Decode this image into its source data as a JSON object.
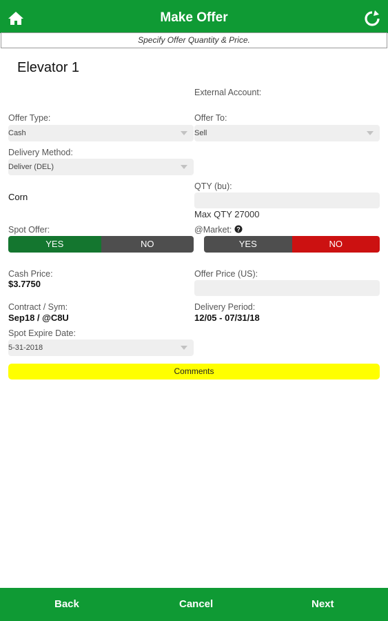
{
  "header": {
    "title": "Make Offer",
    "home_icon": "home-icon",
    "refresh_icon": "refresh-icon"
  },
  "subheader": {
    "text": "Specify Offer Quantity & Price."
  },
  "elevator": {
    "name": "Elevator 1"
  },
  "external_account": {
    "label": "External Account:"
  },
  "offer_type": {
    "label": "Offer Type:",
    "value": "Cash"
  },
  "offer_to": {
    "label": "Offer To:",
    "value": "Sell"
  },
  "delivery_method": {
    "label": "Delivery Method:",
    "value": "Deliver (DEL)"
  },
  "commodity": {
    "value": "Corn"
  },
  "qty": {
    "label": "QTY (bu):",
    "value": "",
    "max_text": "Max QTY 27000"
  },
  "spot_offer": {
    "label": "Spot Offer:",
    "yes": "YES",
    "no": "NO",
    "selected": "YES"
  },
  "at_market": {
    "label": "@Market:",
    "help_icon": "help-icon",
    "yes": "YES",
    "no": "NO",
    "selected": "NO"
  },
  "cash_price": {
    "label": "Cash Price:",
    "value": "$3.7750"
  },
  "offer_price": {
    "label": "Offer Price (US):",
    "value": ""
  },
  "contract": {
    "label": "Contract / Sym:",
    "value": "Sep18 / @C8U"
  },
  "delivery_period": {
    "label": "Delivery Period:",
    "value": "12/05 - 07/31/18"
  },
  "spot_expire": {
    "label": "Spot Expire Date:",
    "value": "5-31-2018"
  },
  "comments": {
    "label": "Comments"
  },
  "footer": {
    "back": "Back",
    "cancel": "Cancel",
    "next": "Next"
  },
  "colors": {
    "brand_green": "#0f9a34",
    "toggle_yes": "#14762f",
    "toggle_no_active": "#cc1111",
    "comments_yellow": "#ffff00"
  }
}
